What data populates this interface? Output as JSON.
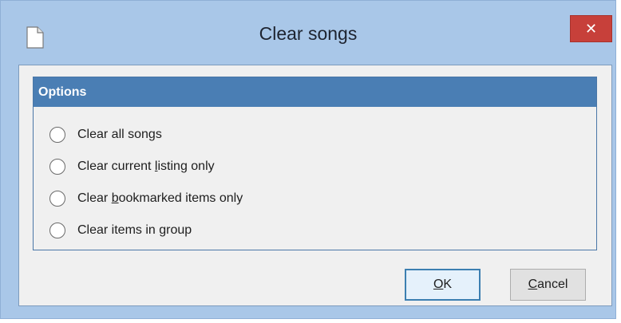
{
  "window": {
    "title": "Clear songs",
    "close_glyph": "✕",
    "app_icon": "document-icon",
    "colors": {
      "frame": "#a9c7e8",
      "group_header": "#4a7eb4",
      "close_button": "#c7403a"
    }
  },
  "options_group": {
    "title": "Options",
    "items": [
      {
        "pre": "Clear all songs",
        "ul": "",
        "post": ""
      },
      {
        "pre": "Clear current ",
        "ul": "l",
        "post": "isting only"
      },
      {
        "pre": "Clear ",
        "ul": "b",
        "post": "ookmarked items only"
      },
      {
        "pre": "Clear items in ",
        "ul": "g",
        "post": "roup"
      }
    ]
  },
  "buttons": {
    "ok": {
      "ul": "O",
      "post": "K"
    },
    "cancel": {
      "ul": "C",
      "post": "ancel"
    }
  }
}
